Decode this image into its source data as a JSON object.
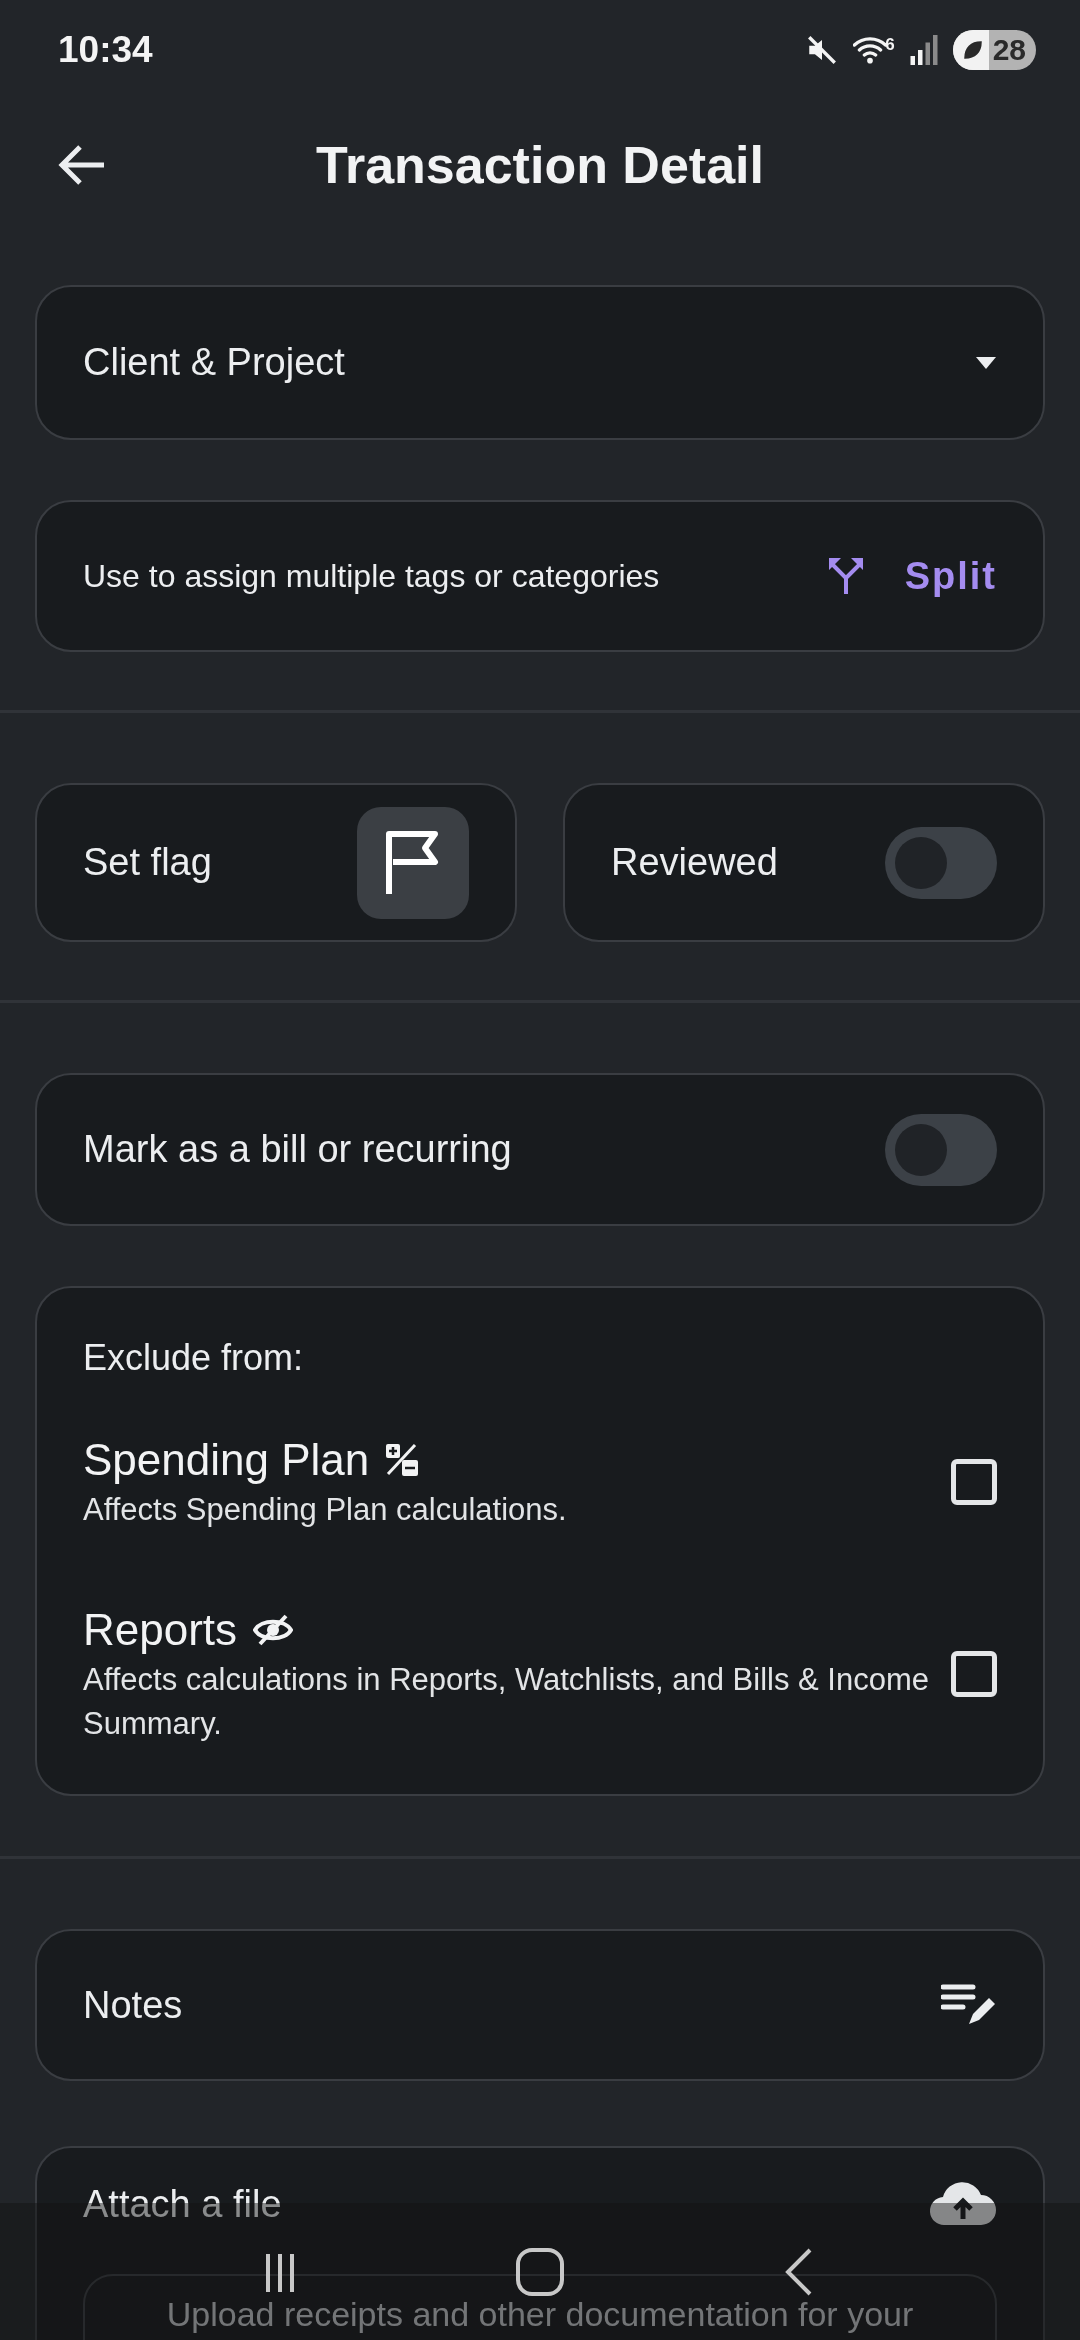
{
  "status_bar": {
    "time": "10:34",
    "wifi_badge": "6",
    "battery": "28"
  },
  "header": {
    "title": "Transaction Detail"
  },
  "client_project": {
    "label": "Client & Project"
  },
  "split": {
    "hint": "Use to assign multiple tags or categories",
    "button": "Split"
  },
  "flag": {
    "label": "Set flag",
    "flagged": false
  },
  "reviewed": {
    "label": "Reviewed",
    "on": false
  },
  "recurring": {
    "label": "Mark as a bill or recurring",
    "on": false
  },
  "exclude": {
    "title": "Exclude from:",
    "options": [
      {
        "kind": "plan",
        "title": "Spending Plan",
        "description": "Affects Spending Plan calculations.",
        "checked": false
      },
      {
        "kind": "hidden",
        "title": "Reports",
        "description": "Affects calculations in Reports, Watchlists, and Bills & Income Summary.",
        "checked": false
      }
    ]
  },
  "notes": {
    "label": "Notes"
  },
  "attachment": {
    "label": "Attach a file",
    "dropzone_text": "Upload receipts and other documentation for your"
  }
}
